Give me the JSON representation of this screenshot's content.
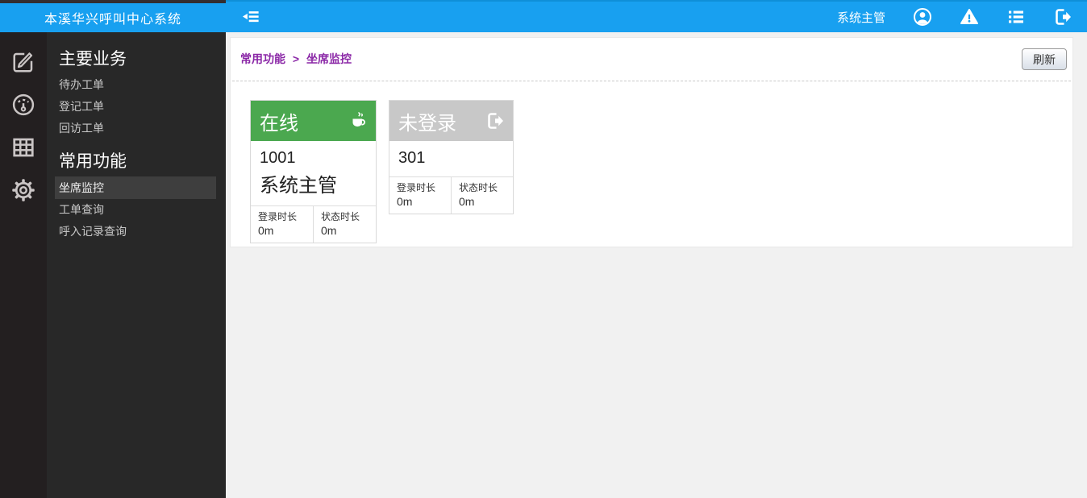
{
  "app": {
    "title": "本溪华兴呼叫中心系统"
  },
  "topbar": {
    "username": "系统主管",
    "icons": [
      "collapse-sidebar-icon",
      "user-icon",
      "warning-icon",
      "list-icon",
      "logout-icon"
    ]
  },
  "sidebar": {
    "rail_icons": [
      "edit-icon",
      "gauge-icon",
      "table-icon",
      "gear-icon"
    ],
    "sections": [
      {
        "title": "主要业务",
        "items": [
          {
            "label": "待办工单"
          },
          {
            "label": "登记工单"
          },
          {
            "label": "回访工单"
          }
        ]
      },
      {
        "title": "常用功能",
        "items": [
          {
            "label": "坐席监控",
            "selected": true
          },
          {
            "label": "工单查询"
          },
          {
            "label": "呼入记录查询"
          }
        ]
      }
    ]
  },
  "breadcrumb": {
    "parent": "常用功能",
    "separator": ">",
    "current": "坐席监控"
  },
  "toolbar": {
    "refresh_label": "刷新"
  },
  "cards": {
    "online": {
      "status": "在线",
      "header_color": "#4ba84f",
      "icon": "coffee-cup-icon",
      "agent_id": "1001",
      "agent_name": "系统主管",
      "login_label": "登录时长",
      "login_value": "0m",
      "state_label": "状态时长",
      "state_value": "0m"
    },
    "offline": {
      "status": "未登录",
      "header_color": "#c8c8c8",
      "icon": "logout-icon",
      "agent_id": "301",
      "login_label": "登录时长",
      "login_value": "0m",
      "state_label": "状态时长",
      "state_value": "0m"
    }
  },
  "colors": {
    "topbar_blue": "#18a0f0",
    "rail_bg": "#231f20",
    "menu_bg": "#282828",
    "menu_selected_bg": "#3e3e3e",
    "breadcrumb_purple": "#8b28a7",
    "online_green": "#4ba84f",
    "offline_gray": "#c8c8c8",
    "main_bg": "#f1f1f1"
  }
}
